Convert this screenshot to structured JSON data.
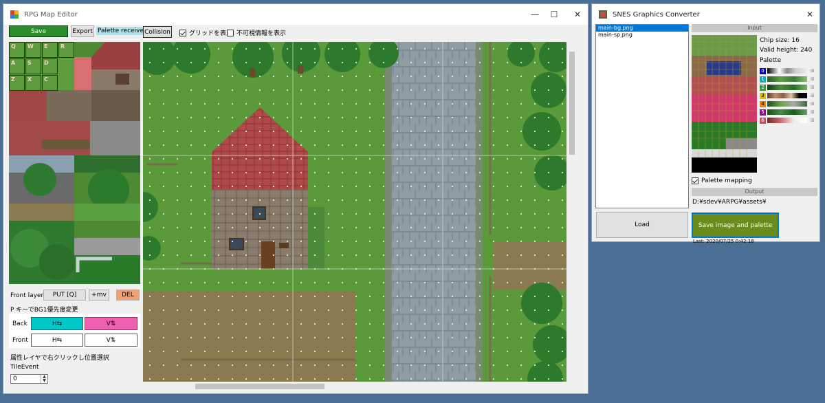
{
  "editor": {
    "title": "RPG Map Editor",
    "titlebar": {
      "minimize": "—",
      "maximize": "☐",
      "close": "✕"
    },
    "toolbar": {
      "save": "Save",
      "export": "Export",
      "palette_status": "Palette received!",
      "collision": "Collision",
      "show_grid": "グリッドを表示",
      "show_grid_checked": true,
      "show_impassable": "不可視情報を表示",
      "show_impassable_checked": false
    },
    "tile_keys": [
      "Q",
      "W",
      "E",
      "R",
      "A",
      "S",
      "D",
      "Z",
      "X",
      "C"
    ],
    "front_layer_label": "Front layer",
    "put_button": "PUT [Q]",
    "mv_button": "+mv",
    "del_button": "DEL",
    "priority_hint": "P キーでBG1優先度変更",
    "back_label": "Back",
    "front_label": "Front",
    "back_h": "H⇆",
    "back_v": "V⇅",
    "front_h": "H⇆",
    "front_v": "V⇅",
    "attr_hint": "属性レイヤで右クリックし位置選択",
    "tile_event_label": "TileEvent",
    "tile_event_value": "0"
  },
  "snes": {
    "title": "SNES Graphics Converter",
    "close": "✕",
    "files": [
      "main-bg.png",
      "main-sp.png"
    ],
    "selected_file": 0,
    "input_header": "Input",
    "chip_size": "Chip size: 16",
    "valid_height": "Valid height: 240",
    "palette_label": "Palette",
    "palette_indices": [
      "0",
      "1",
      "2",
      "3",
      "4",
      "5",
      "6"
    ],
    "palette_mapping": "Palette mapping",
    "palette_mapping_checked": true,
    "output_header": "Output",
    "output_path": "D:¥sdev¥ARPG¥assets¥",
    "load_button": "Load",
    "save_button": "Save image and palette",
    "last_saved": "Last: 2020/07/25 0:42:18"
  },
  "colors": {
    "save_green": "#2a8c2a",
    "teal": "#00c8c8",
    "pink": "#f060b0",
    "del_orange": "#f4a070",
    "olive_save": "#6a8c1e",
    "grass": "#5a9a3a",
    "road": "#8c9aa4"
  }
}
